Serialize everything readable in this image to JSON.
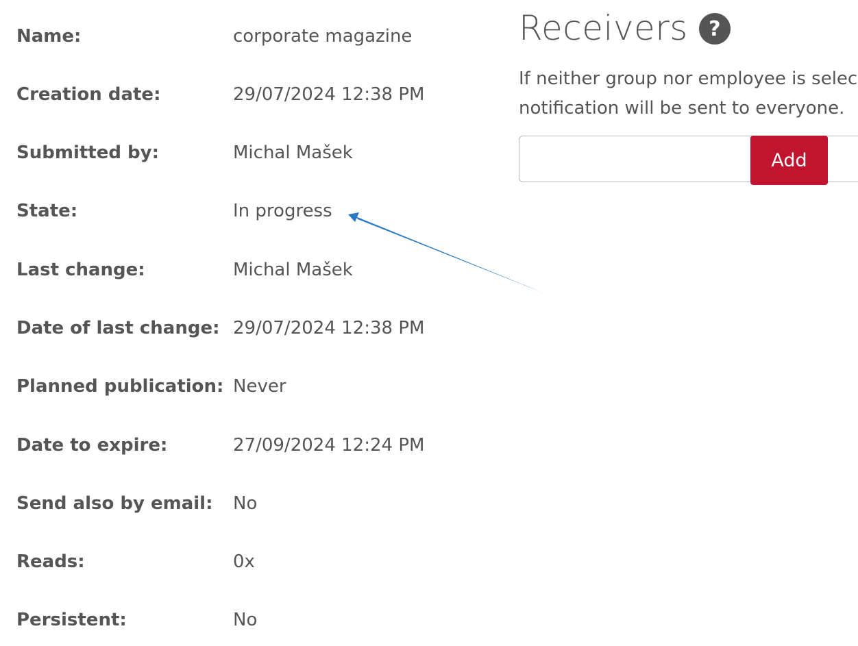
{
  "details": [
    {
      "label": "Name:",
      "value": "corporate magazine"
    },
    {
      "label": "Creation date:",
      "value": "29/07/2024 12:38 PM"
    },
    {
      "label": "Submitted by:",
      "value": "Michal Mašek"
    },
    {
      "label": "State:",
      "value": "In progress"
    },
    {
      "label": "Last change:",
      "value": "Michal Mašek"
    },
    {
      "label": "Date of last change:",
      "value": "29/07/2024 12:38 PM"
    },
    {
      "label": "Planned publication:",
      "value": "Never"
    },
    {
      "label": "Date to expire:",
      "value": "27/09/2024 12:24 PM"
    },
    {
      "label": "Send also by email:",
      "value": "No"
    },
    {
      "label": "Reads:",
      "value": "0x"
    },
    {
      "label": "Persistent:",
      "value": "No"
    }
  ],
  "receivers": {
    "title": "Receivers",
    "help_icon": "?",
    "note_line1": "If neither group nor employee is selec",
    "note_line2": "notification will be sent to everyone.",
    "input_value": "",
    "add_label": "Add"
  },
  "annotation": {
    "icon": "arrow-annotation",
    "color": "#2a7bc4"
  }
}
